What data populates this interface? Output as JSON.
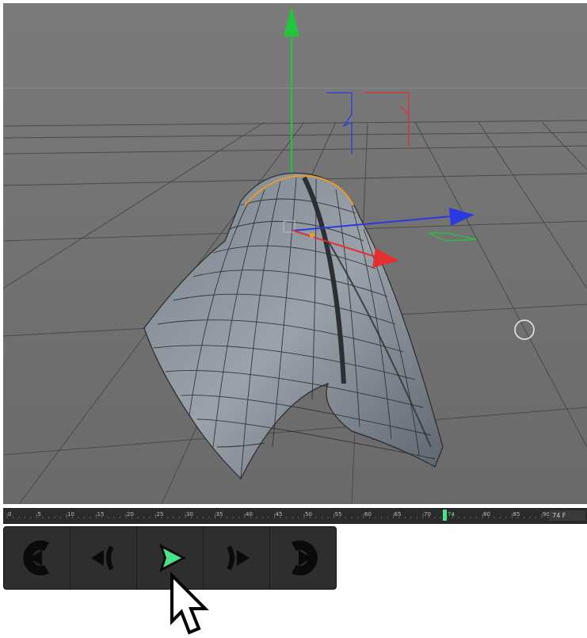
{
  "viewport": {
    "background": "#6e6e6e",
    "axis_colors": {
      "x": "#e03030",
      "y": "#22c63a",
      "z": "#2a3ae0"
    }
  },
  "timeline": {
    "ticks": [
      "0",
      "5",
      "10",
      "15",
      "20",
      "25",
      "30",
      "35",
      "40",
      "45",
      "50",
      "55",
      "60",
      "65",
      "70",
      "74",
      "80",
      "85",
      "90"
    ],
    "current_frame_label": "74",
    "frame_field": "74 F",
    "playhead_color": "#4fe08a"
  },
  "transport": {
    "buttons": [
      {
        "name": "go-to-start-button",
        "icon": "go-to-start-icon"
      },
      {
        "name": "step-back-button",
        "icon": "step-back-icon"
      },
      {
        "name": "play-button",
        "icon": "play-icon",
        "active": true
      },
      {
        "name": "step-forward-button",
        "icon": "step-forward-icon"
      },
      {
        "name": "go-to-end-button",
        "icon": "go-to-end-icon"
      }
    ],
    "accent": "#4fe08a"
  }
}
